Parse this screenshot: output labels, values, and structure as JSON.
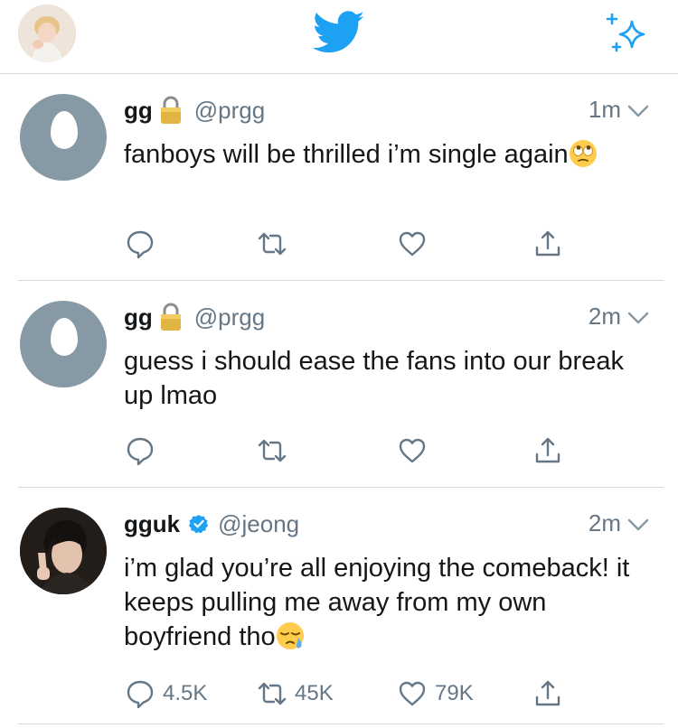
{
  "app": {
    "logo_icon": "twitter-bird-icon",
    "sparkle_icon": "sparkle-icon",
    "brand_color": "#1da1f2"
  },
  "tweets": [
    {
      "name": "gg",
      "handle": "@prgg",
      "time": "1m",
      "protected": true,
      "text": "fanboys will be thrilled i’m single again",
      "emoji": "face-with-rolling-eyes",
      "counts": {
        "reply": "",
        "retweet": "",
        "like": ""
      }
    },
    {
      "name": "gg",
      "handle": "@prgg",
      "time": "2m",
      "protected": true,
      "text": "guess i should ease the fans into our break up lmao",
      "emoji": "",
      "counts": {
        "reply": "",
        "retweet": "",
        "like": ""
      }
    },
    {
      "name": "gguk",
      "handle": "@jeong",
      "time": "2m",
      "verified": true,
      "text": "i’m glad you’re all enjoying the comeback! it keeps pulling me away from my own boyfriend tho",
      "emoji": "sleepy-face",
      "counts": {
        "reply": "4.5K",
        "retweet": "45K",
        "like": "79K"
      }
    }
  ]
}
